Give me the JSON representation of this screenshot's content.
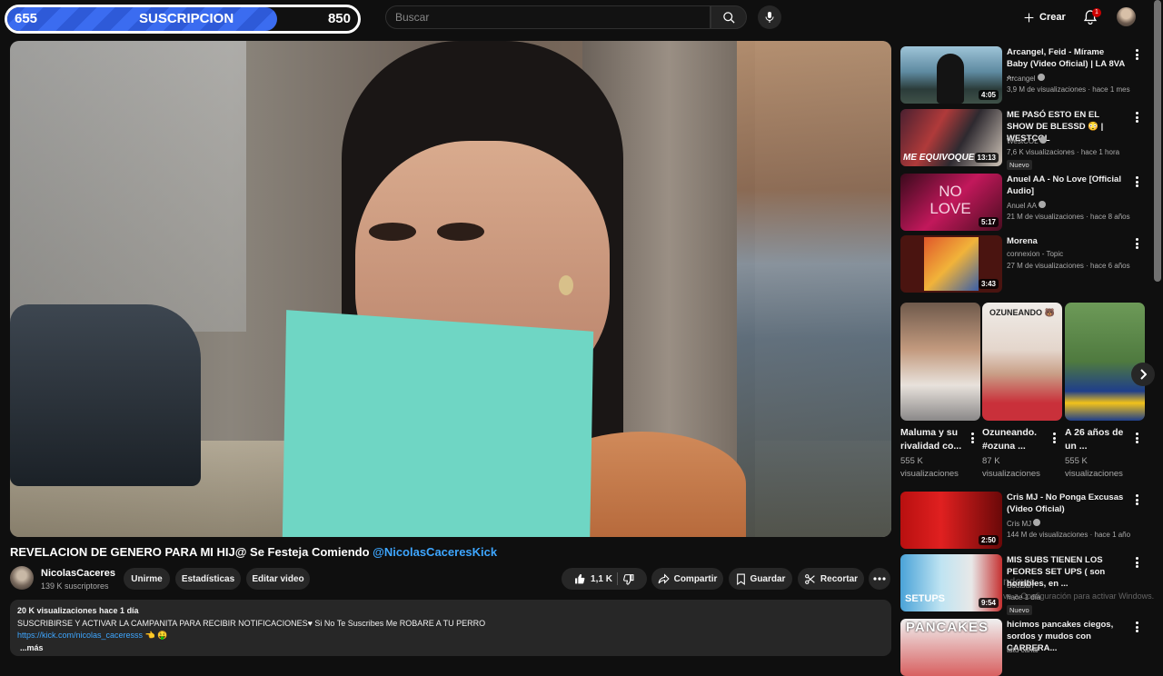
{
  "sub_goal": {
    "current": "655",
    "label": "SUSCRIPCION",
    "target": "850",
    "progress_fraction": 0.77
  },
  "header": {
    "search_placeholder": "Buscar",
    "create_label": "Crear",
    "notification_count": "1",
    "icons": [
      "search-icon",
      "mic-icon",
      "plus-icon",
      "bell-icon"
    ]
  },
  "video": {
    "title": "REVELACION DE GENERO PARA MI HIJ@ Se Festeja Comiendo ",
    "title_mention": "@NicolasCaceresKick",
    "channel_name": "NicolasCaceres",
    "subscribers": "139 K suscriptores",
    "buttons": {
      "join": "Unirme",
      "stats": "Estadísticas",
      "edit": "Editar video",
      "likes": "1,1 K",
      "share": "Compartir",
      "save": "Guardar",
      "clip": "Recortar"
    }
  },
  "description": {
    "views_date": "20 K visualizaciones  hace 1 día",
    "line1": "SUSCRIBIRSE Y ACTIVAR LA CAMPANITA PARA RECIBIR NOTIFICACIONES♥  Si No Te Suscribes Me ROBARE A TU PERRO",
    "link": "https://kick.com/nicolas_caceresss",
    "link_emoji": "👈 🤑",
    "more": "...más"
  },
  "related": [
    {
      "title": "Arcangel, Feid - Mírame Baby (Video Oficial) | LA 8VA ...",
      "channel": "Arcangel",
      "verified": true,
      "views": "3,9 M de visualizaciones · hace 1 mes",
      "duration": "4:05",
      "new": ""
    },
    {
      "title": "ME PASÓ ESTO EN EL SHOW DE BLESSD 😳 | WESTCOL",
      "channel": "WestCOL",
      "verified": true,
      "views": "7,6 K visualizaciones · hace 1 hora",
      "duration": "13:13",
      "new": "Nuevo",
      "thumb_text": "ME EQUIVOQUE"
    },
    {
      "title": "Anuel AA - No Love [Official Audio]",
      "channel": "Anuel AA",
      "verified": true,
      "views": "21 M de visualizaciones · hace 8 años",
      "duration": "5:17",
      "new": "",
      "thumb_text": "NO LOVE"
    },
    {
      "title": "Morena",
      "channel": "connexion - Topic",
      "verified": false,
      "views": "27 M de visualizaciones · hace 6 años",
      "duration": "3:43",
      "new": ""
    }
  ],
  "shorts": [
    {
      "title": "Maluma y su rivalidad co...",
      "views": "555 K visualizaciones",
      "thumb_text": ""
    },
    {
      "title": "Ozuneando. #ozuna ...",
      "views": "87 K visualizaciones",
      "thumb_text": "OZUNEANDO 🐻"
    },
    {
      "title": "A 26 años de un ...",
      "views": "555 K visualizaciones",
      "thumb_text": ""
    }
  ],
  "related_more": [
    {
      "title": "Cris MJ - No Ponga Excusas (Video Oficial)",
      "channel": "Cris MJ",
      "verified": true,
      "views": "144 M de visualizaciones · hace 1 año",
      "duration": "2:50",
      "new": ""
    },
    {
      "title": "MIS SUBS TIENEN LOS PEORES SET UPS ( son horribles, en ...",
      "channel": "Soutsun",
      "verified": false,
      "views": "hace 1 día",
      "duration": "9:54",
      "new": "Nuevo",
      "thumb_text": "SETUPS"
    },
    {
      "title": "hicimos pancakes ciegos, sordos y mudos con CARRERA...",
      "channel": "tdtu canal",
      "verified": false,
      "views": "",
      "duration": "",
      "new": "",
      "thumb_text": "PANCAKES"
    }
  ],
  "watermark": {
    "line1": "ndows",
    "line2": "ve a Configuración para activar Windows."
  },
  "colors": {
    "background": "#0f0f0f",
    "pill": "#272727",
    "link": "#3ea6ff",
    "progress": "#3b6cf0",
    "badge": "#cc0000"
  }
}
